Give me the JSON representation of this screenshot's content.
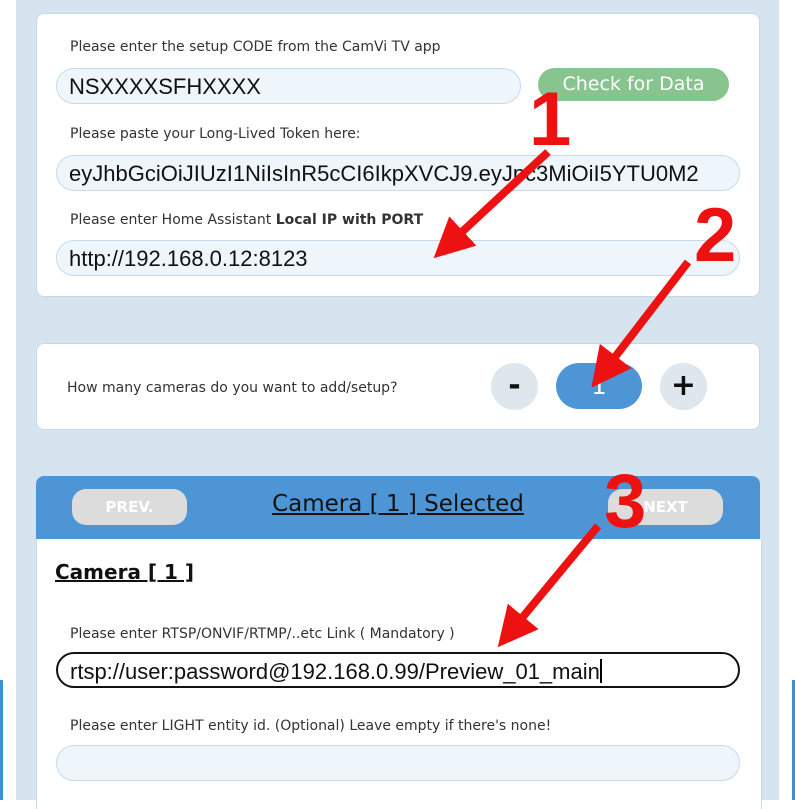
{
  "setup": {
    "code_label": "Please enter the setup CODE from the CamVi TV app",
    "code_value": "NSXXXXSFHXXXX",
    "check_button": "Check for Data",
    "token_label": "Please paste your Long-Lived Token here:",
    "token_value": "eyJhbGciOiJIUzI1NiIsInR5cCI6IkpXVCJ9.eyJpc3MiOiI5YTU0M2",
    "ip_label_prefix": "Please enter Home Assistant ",
    "ip_label_bold": "Local IP with PORT",
    "ip_value": "http://192.168.0.12:8123"
  },
  "cameras_count": {
    "label": "How many cameras do you want to add/setup?",
    "minus": "-",
    "value": "1",
    "plus": "+"
  },
  "camera_panel": {
    "prev_button": "PREV.",
    "title": "Camera [ 1 ] Selected",
    "next_button": "NEXT",
    "camera_heading": "Camera [ 1 ]",
    "rtsp_label": "Please enter RTSP/ONVIF/RTMP/..etc Link ( Mandatory )",
    "rtsp_value": "rtsp://user:password@192.168.0.99/Preview_01_main",
    "light_label": "Please enter LIGHT entity id. (Optional) Leave empty if there's none!",
    "light_value": ""
  },
  "annotations": [
    "1",
    "2",
    "3"
  ],
  "colors": {
    "accent_blue": "#4e95d6",
    "check_green": "#88c48e",
    "annotation_red": "#ee1111",
    "page_bg": "#d6e4ef"
  }
}
